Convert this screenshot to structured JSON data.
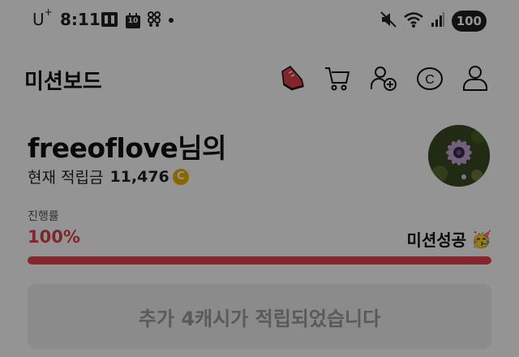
{
  "status_bar": {
    "carrier": "U",
    "carrier_suffix": "+",
    "time": "8:11",
    "calendar_day": "10",
    "battery": "100",
    "left_icons": [
      "sim-card-icon",
      "calendar-icon",
      "app-grid-icon",
      "notification-dot-icon"
    ],
    "right_icons": [
      "mute-icon",
      "wifi-icon",
      "signal-icon",
      "battery-icon"
    ]
  },
  "header": {
    "title": "미션보드",
    "actions": [
      {
        "name": "sneaker-icon",
        "color": "#e0424b"
      },
      {
        "name": "cart-icon"
      },
      {
        "name": "add-friend-icon"
      },
      {
        "name": "cash-icon"
      },
      {
        "name": "profile-icon"
      }
    ]
  },
  "profile": {
    "greeting": "freeoflove님의",
    "points_label": "현재 적립금",
    "points_value": "11,476",
    "coin_symbol": "C"
  },
  "progress": {
    "label": "진행률",
    "value": "100%",
    "fraction": 1.0,
    "status": "미션성공",
    "status_emoji": "🥳"
  },
  "notice": {
    "text": "추가 4캐시가 적립되었습니다"
  },
  "colors": {
    "accent_red": "#e4434d",
    "coin_gold": "#e9b200",
    "overlay": "rgba(0,0,0,0.42)"
  }
}
